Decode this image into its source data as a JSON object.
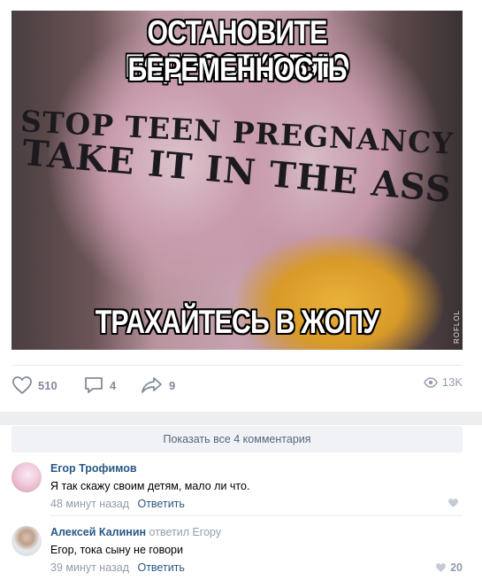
{
  "post": {
    "image": {
      "caption_top_line1": "ОСТАНОВИТЕ ПОДРОСТКОВУЮ",
      "caption_top_line2": "БЕРЕМЕННОСТЬ",
      "shirt_line1": "STOP TEEN PREGNANCY",
      "shirt_line2": "TAKE IT IN THE ASS",
      "caption_bottom": "ТРАХАЙТЕСЬ В ЖОПУ",
      "watermark": "ROFLOL"
    },
    "actions": {
      "likes": "510",
      "comments": "4",
      "shares": "9",
      "views": "13K",
      "icons": [
        "heart-icon",
        "comment-icon",
        "share-icon",
        "eye-icon"
      ]
    }
  },
  "comments_section": {
    "show_all_label": "Показать все 4 комментария",
    "items": [
      {
        "author": "Егор Трофимов",
        "replied_to": "",
        "text": "Я так скажу своим детям, мало ли что.",
        "time": "48 минут назад",
        "reply_label": "Ответить",
        "likes": ""
      },
      {
        "author": "Алексей Калинин",
        "replied_to": "ответил Егору",
        "text": "Егор, тока сыну не говори",
        "time": "39 минут назад",
        "reply_label": "Ответить",
        "likes": "20"
      }
    ]
  },
  "colors": {
    "link": "#2a5885",
    "muted": "#939cab",
    "icon": "#828a99",
    "divider": "#e7e8ec",
    "band": "#edeef0"
  }
}
